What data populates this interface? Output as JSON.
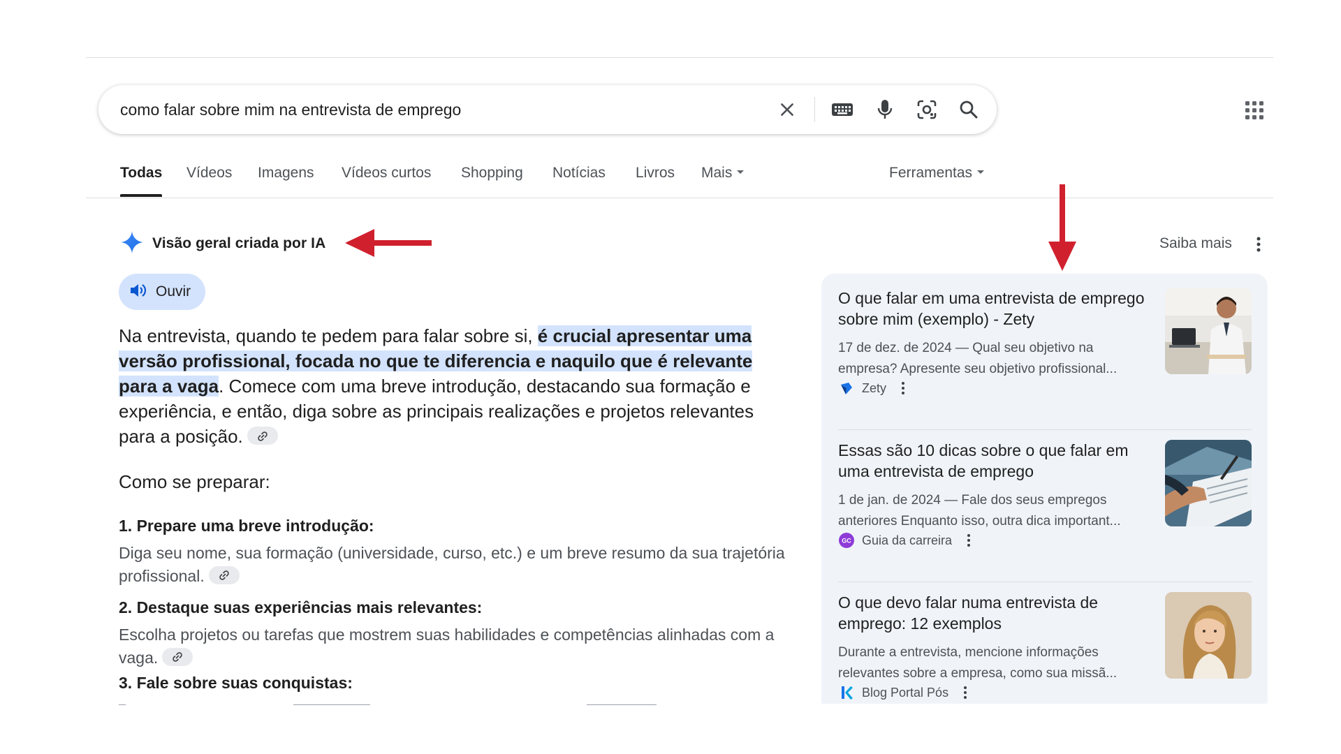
{
  "search": {
    "query": "como falar sobre mim na entrevista de emprego"
  },
  "tabs": [
    {
      "label": "Todas",
      "active": true
    },
    {
      "label": "Vídeos"
    },
    {
      "label": "Imagens"
    },
    {
      "label": "Vídeos curtos"
    },
    {
      "label": "Shopping"
    },
    {
      "label": "Notícias"
    },
    {
      "label": "Livros"
    },
    {
      "label": "Mais"
    }
  ],
  "tools_label": "Ferramentas",
  "ai_overview": {
    "title": "Visão geral criada por IA",
    "learn_more": "Saiba mais",
    "listen_label": "Ouvir",
    "paragraph": {
      "part1": "Na entrevista, quando te pedem para falar sobre si, ",
      "highlight": "é crucial apresentar uma versão profissional, focada no que te diferencia e naquilo que é relevante para a vaga",
      "part2": ". Comece com uma breve introdução, destacando sua formação e experiência, e então, diga sobre as principais realizações e projetos relevantes para a posição."
    },
    "prep_heading": "Como se preparar:",
    "steps": [
      {
        "title": "1. Prepare uma breve introdução:",
        "desc": "Diga seu nome, sua formação (universidade, curso, etc.) e um breve resumo da sua trajetória profissional."
      },
      {
        "title": "2. Destaque suas experiências mais relevantes:",
        "desc": "Escolha projetos ou tarefas que mostrem suas habilidades e competências alinhadas com a vaga."
      },
      {
        "title": "3. Fale sobre suas conquistas:",
        "desc": ""
      }
    ]
  },
  "sources": [
    {
      "title": "O que falar em uma entrevista de emprego sobre mim (exemplo) - Zety",
      "snippet_line1": "17 de dez. de 2024 — Qual seu objetivo na",
      "snippet_line2": "empresa? Apresente seu objetivo profissional...",
      "source": "Zety",
      "favicon": "zety-logo"
    },
    {
      "title": "Essas são 10 dicas sobre o que falar em uma entrevista de emprego",
      "snippet_line1": "1 de jan. de 2024 — Fale dos seus empregos",
      "snippet_line2": "anteriores Enquanto isso, outra dica important...",
      "source": "Guia da carreira",
      "favicon": "guia-da-carreira-logo"
    },
    {
      "title": "O que devo falar numa entrevista de emprego: 12 exemplos",
      "snippet_line1": "Durante a entrevista, mencione informações",
      "snippet_line2": "relevantes sobre a empresa, como sua missã...",
      "source": "Blog Portal Pós",
      "favicon": "portal-pos-logo"
    }
  ],
  "colors": {
    "accent_blue": "#1a73e8",
    "highlight_bg": "#d3e3fd",
    "panel_bg": "#f0f4f9",
    "annotation_red": "#d0202e"
  }
}
